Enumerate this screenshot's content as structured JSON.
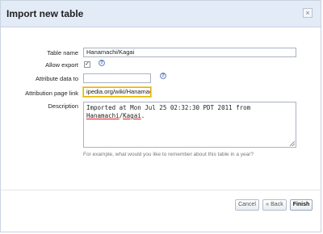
{
  "dialog": {
    "title": "Import new table",
    "close_glyph": "×",
    "close_icon": "close-icon"
  },
  "form": {
    "table_name": {
      "label": "Table name",
      "value": "Hanamachi/Kagai"
    },
    "allow_export": {
      "label": "Allow export",
      "checked": true,
      "glyph": "✓",
      "help": "?"
    },
    "attribute_data_to": {
      "label": "Attribute data to",
      "value": "",
      "help": "?"
    },
    "attribution_page_link": {
      "label": "Attribution page link",
      "value": "ipedia.org/wiki/Hanamachi"
    },
    "description": {
      "label": "Description",
      "line1": "Imported at Mon Jul 25 02:32:30 PDT 2011 from",
      "word1": "Hanamachi",
      "sep": "/",
      "word2": "Kagai",
      "end": ".",
      "hint": "For example, what would you like to remember about this table in a year?"
    }
  },
  "buttons": {
    "cancel": "Cancel",
    "back": "« Back",
    "finish": "Finish"
  },
  "colors": {
    "titlebar_bg": "#e3ebf7",
    "focus_border": "#e0b300",
    "help_icon": "#3d5f9c"
  }
}
